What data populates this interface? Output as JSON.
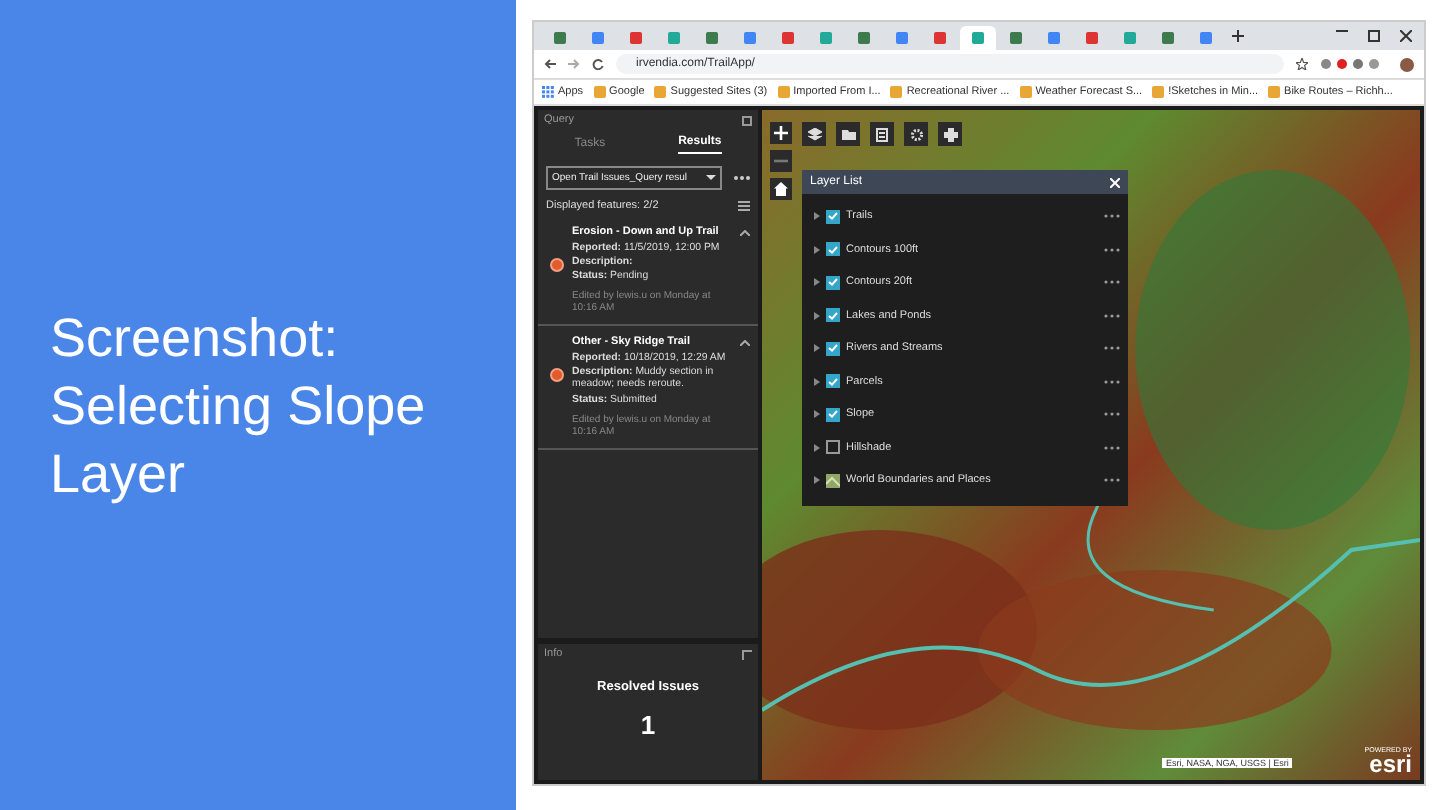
{
  "slide": {
    "title": "Screenshot: Selecting Slope Layer"
  },
  "browser": {
    "tabs": [
      {
        "selected": false
      },
      {
        "selected": false
      },
      {
        "selected": false
      },
      {
        "selected": false
      },
      {
        "selected": false
      },
      {
        "selected": false
      },
      {
        "selected": false
      },
      {
        "selected": false
      },
      {
        "selected": false
      },
      {
        "selected": false
      },
      {
        "selected": false
      },
      {
        "selected": true
      },
      {
        "selected": false
      },
      {
        "selected": false
      },
      {
        "selected": false
      },
      {
        "selected": false
      },
      {
        "selected": false
      },
      {
        "selected": false
      }
    ],
    "url": "irvendia.com/TrailApp/",
    "bookmarks": [
      "Apps",
      "Google",
      "Suggested Sites (3)",
      "Imported From I...",
      "Recreational River ...",
      "Weather Forecast S...",
      "!Sketches in Min...",
      "Bike Routes – Richh..."
    ]
  },
  "query_panel": {
    "title": "Query",
    "tabs": [
      {
        "label": "Tasks",
        "selected": false
      },
      {
        "label": "Results",
        "selected": true
      }
    ],
    "dropdown": "Open Trail Issues_Query resul",
    "displayed": "Displayed features: 2/2",
    "results": [
      {
        "title": "Erosion - Down and Up Trail",
        "reported": "**Reported:** 11/5/2019, 12:00 PM",
        "description": "**Description:**",
        "status": "**Status:** Pending",
        "edited": "Edited by lewis.u on Monday at 10:16 AM"
      },
      {
        "title": "Other - Sky Ridge Trail",
        "reported": "**Reported:** 10/18/2019, 12:29 AM",
        "description": "**Description:** Muddy section in meadow; needs reroute.",
        "status": "**Status:** Submitted",
        "edited": "Edited by lewis.u on Monday at 10:16 AM"
      }
    ]
  },
  "info_panel": {
    "title": "Info",
    "heading": "Resolved Issues",
    "count": "1"
  },
  "layer_list": {
    "title": "Layer List",
    "layers": [
      {
        "kind": "checkbox",
        "label": "Trails",
        "checked": true
      },
      {
        "kind": "checkbox",
        "label": "Contours 100ft",
        "checked": true
      },
      {
        "kind": "checkbox",
        "label": "Contours 20ft",
        "checked": true
      },
      {
        "kind": "checkbox",
        "label": "Lakes and Ponds",
        "checked": true
      },
      {
        "kind": "checkbox",
        "label": "Rivers and Streams",
        "checked": true
      },
      {
        "kind": "checkbox",
        "label": "Parcels",
        "checked": true
      },
      {
        "kind": "checkbox",
        "label": "Slope",
        "checked": true
      },
      {
        "kind": "checkbox",
        "label": "Hillshade",
        "checked": false
      },
      {
        "kind": "basemap",
        "label": "World Boundaries and Places"
      }
    ]
  },
  "map": {
    "attribution": "Esri, NASA, NGA, USGS | Esri",
    "logo_caption": "POWERED BY",
    "logo": "esri"
  }
}
